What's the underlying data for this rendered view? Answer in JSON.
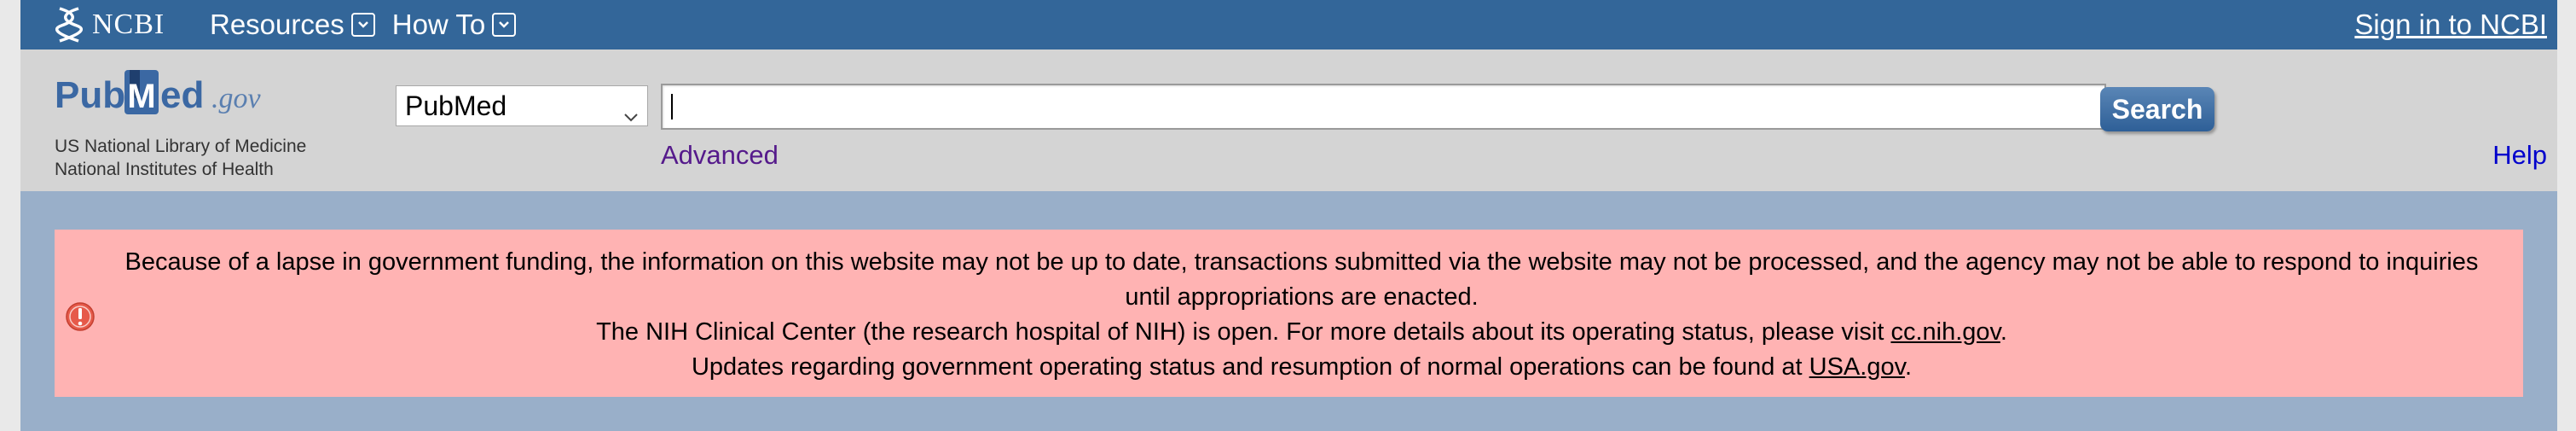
{
  "topbar": {
    "logo_text": "NCBI",
    "nav": [
      {
        "label": "Resources"
      },
      {
        "label": "How To"
      }
    ],
    "signin_label": "Sign in to NCBI"
  },
  "header": {
    "logo": {
      "pub": "Pub",
      "m": "M",
      "ed": "ed",
      "gov": ".gov"
    },
    "tagline_line1": "US National Library of Medicine",
    "tagline_line2": "National Institutes of Health",
    "database_selected": "PubMed",
    "search_value": "",
    "search_button_label": "Search",
    "advanced_label": "Advanced",
    "help_label": "Help"
  },
  "alert": {
    "line1": "Because of a lapse in government funding, the information on this website may not be up to date, transactions submitted via the website may not be processed, and the agency may not be able to respond to inquiries until appropriations are enacted.",
    "line2_prefix": "The NIH Clinical Center (the research hospital of NIH) is open. For more details about its operating status, please visit ",
    "line2_link": "cc.nih.gov",
    "line2_suffix": ".",
    "line3_prefix": "Updates regarding government operating status and resumption of normal operations can be found at ",
    "line3_link": "USA.gov",
    "line3_suffix": "."
  },
  "colors": {
    "topbar": "#336699",
    "header_bg": "#d4d4d4",
    "alert_region": "#99afc9",
    "alert_bg": "#ffb3b3",
    "alert_icon": "#e65a4a",
    "pubmed_blue": "#3b68a3"
  },
  "icons": {
    "ncbi": "ncbi-helix-icon",
    "dropdown": "chevron-down-icon",
    "alert": "exclamation-icon"
  }
}
